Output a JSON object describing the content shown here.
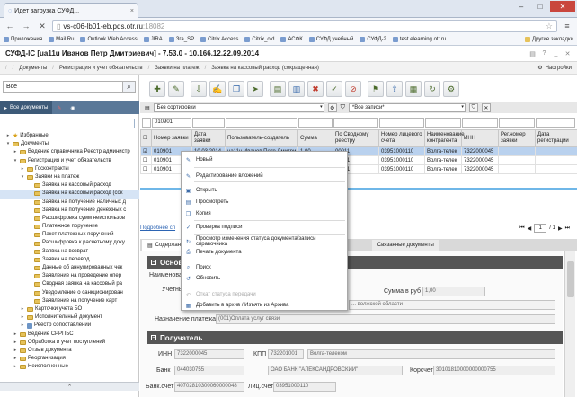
{
  "browser": {
    "tab_title": "Идет загрузка СУФД...",
    "url_domain": "vs-c06-lb01-eb.pds.otr.ru",
    "url_port": ":18082",
    "bookmarks": [
      "Приложения",
      "Mail.Ru",
      "Outlook Web Access",
      "JIRA",
      "Зга_SP",
      "Citrix Access",
      "Citrix_old",
      "АСФК",
      "СУФД учебный",
      "СУФД-2",
      "test.elearning.otr.ru"
    ],
    "other_bookmarks": "Другие закладки"
  },
  "app": {
    "title": "СУФД-IC [ua11u Иванов Петр Дмитриевич] - 7.53.0 - 10.166.12.22.09.2014",
    "breadcrumbs": [
      "Документы",
      "Регистрация и учет обязательств",
      "Заявки на платеж",
      "Заявка на кассовый расход (сокращенная)"
    ],
    "settings": "Настройки"
  },
  "left": {
    "search_value": "Все",
    "tab_all": "Все документы",
    "tree": [
      {
        "label": "Избранные",
        "level": 0,
        "exp": "▸",
        "icon": "star"
      },
      {
        "label": "Документы",
        "level": 0,
        "exp": "▾",
        "icon": "fold"
      },
      {
        "label": "Ведение справочника Реестр администр",
        "level": 1,
        "exp": "▸",
        "icon": "fold"
      },
      {
        "label": "Регистрация и учет обязательств",
        "level": 1,
        "exp": "▾",
        "icon": "fold"
      },
      {
        "label": "Госконтракты",
        "level": 2,
        "exp": "▸",
        "icon": "fold"
      },
      {
        "label": "Заявки на платеж",
        "level": 2,
        "exp": "▾",
        "icon": "fold"
      },
      {
        "label": "Заявка на кассовый расход",
        "level": 3,
        "exp": "",
        "icon": "fold"
      },
      {
        "label": "Заявка на кассовый расход (сок",
        "level": 3,
        "exp": "",
        "icon": "fold",
        "selected": true
      },
      {
        "label": "Заявка на получение наличных д",
        "level": 3,
        "exp": "",
        "icon": "fold"
      },
      {
        "label": "Заявка на получение денежных с",
        "level": 3,
        "exp": "",
        "icon": "fold"
      },
      {
        "label": "Расшифровка сумм неиспользов",
        "level": 3,
        "exp": "",
        "icon": "fold"
      },
      {
        "label": "Платежное поручение",
        "level": 3,
        "exp": "",
        "icon": "fold"
      },
      {
        "label": "Пакет платежных поручений",
        "level": 3,
        "exp": "",
        "icon": "fold"
      },
      {
        "label": "Расшифровка к расчетному доку",
        "level": 3,
        "exp": "",
        "icon": "fold"
      },
      {
        "label": "Заявка на возврат",
        "level": 3,
        "exp": "",
        "icon": "fold"
      },
      {
        "label": "Заявка на перевод",
        "level": 3,
        "exp": "",
        "icon": "fold"
      },
      {
        "label": "Данные об аннулированных чек",
        "level": 3,
        "exp": "",
        "icon": "fold"
      },
      {
        "label": "Заявление на проведение опер",
        "level": 3,
        "exp": "",
        "icon": "fold"
      },
      {
        "label": "Сводная заявка на кассовый ра",
        "level": 3,
        "exp": "",
        "icon": "fold"
      },
      {
        "label": "Уведомление о санкционирован",
        "level": 3,
        "exp": "",
        "icon": "fold"
      },
      {
        "label": "Заявление на получение карт",
        "level": 3,
        "exp": "",
        "icon": "fold"
      },
      {
        "label": "Карточки учета БО",
        "level": 2,
        "exp": "▸",
        "icon": "fold"
      },
      {
        "label": "Исполнительный документ",
        "level": 2,
        "exp": "▸",
        "icon": "fold"
      },
      {
        "label": "Реестр сопоставлений",
        "level": 2,
        "exp": "▸",
        "icon": "doc"
      },
      {
        "label": "Ведение СРРПБС",
        "level": 1,
        "exp": "▸",
        "icon": "fold"
      },
      {
        "label": "Обработка и учет поступлений",
        "level": 1,
        "exp": "▸",
        "icon": "fold"
      },
      {
        "label": "Отзыв документа",
        "level": 1,
        "exp": "▸",
        "icon": "fold"
      },
      {
        "label": "Реорганизация",
        "level": 1,
        "exp": "▸",
        "icon": "fold"
      },
      {
        "label": "Неисполненные",
        "level": 1,
        "exp": "▸",
        "icon": "fold"
      }
    ]
  },
  "filters": {
    "sort": "Без сортировки",
    "records": "*Все записи*",
    "number_filter": "010901"
  },
  "grid": {
    "columns": [
      "Номер заявки",
      "Дата заявки",
      "Пользователь-создатель",
      "Сумма",
      "По Сводному реестру",
      "Номер лицевого счета",
      "Наименование контрагента",
      "ИНН",
      "Рег.номер заявки",
      "Дата регистрации"
    ],
    "rows": [
      [
        "010901",
        "10.03.2014",
        "ua11u Иванов Петр Дмитри",
        "1,00",
        "00011",
        "03951000110",
        "Волга-телек",
        "7322000045",
        "",
        ""
      ],
      [
        "010901",
        "",
        "",
        "",
        "00011",
        "03951000110",
        "Волга-телек",
        "7322000045",
        "",
        ""
      ],
      [
        "010901",
        "",
        "",
        "",
        "00011",
        "03951000110",
        "Волга-телек",
        "7322000045",
        "",
        ""
      ]
    ]
  },
  "pager": {
    "link": "Подробнее сп",
    "current": "1",
    "total": "/ 1"
  },
  "detail_tabs": [
    "Содержание",
    "Связанные документы"
  ],
  "detail": {
    "section1": "Основн",
    "name_label": "Наименован",
    "participants_label": "Учетны",
    "sum_label": "Сумма в руб",
    "sum_value": "1,00",
    "region_text": "... волжской области",
    "purpose_label": "Назначение платежа",
    "purpose_value": "(001)Оплата услуг связи",
    "section2": "Получатель",
    "inn_label": "ИНН",
    "inn_value": "7322000045",
    "kpp_label": "КПП",
    "kpp_value": "732201001",
    "recipient_value": "Волга-телеком",
    "bank_label": "Банк",
    "bank_code": "044030755",
    "bank_value": "ОАО БАНК \"АЛЕКСАНДРОВСКИЙ\"",
    "corr_label": "Корсчет",
    "corr_value": "30101810000000000755",
    "bank_acct_label": "Банк.счет",
    "bank_acct_value": "40702810300060000048",
    "personal_label": "Лиц.счет",
    "personal_value": "03951000110"
  },
  "context_menu": [
    {
      "label": "Новый",
      "icon": "new-icon",
      "glyph": "✎",
      "disabled": false
    },
    {
      "label": "Редактирование вложений",
      "icon": "attachment-icon",
      "glyph": "✎",
      "disabled": false
    },
    {
      "label": "Открыть",
      "icon": "open-icon",
      "glyph": "▣",
      "disabled": false
    },
    {
      "label": "Просмотреть",
      "icon": "view-icon",
      "glyph": "▤",
      "disabled": false
    },
    {
      "label": "Копия",
      "icon": "copy-icon",
      "glyph": "❐",
      "disabled": false
    },
    {
      "label": "Проверка подписи",
      "icon": "signature-icon",
      "glyph": "✓",
      "disabled": false
    },
    {
      "label": "Просмотр изменения статуса документа/записи справочника",
      "icon": "history-icon",
      "glyph": "↻",
      "disabled": false
    },
    {
      "label": "Печать документа",
      "icon": "print-icon",
      "glyph": "⎙",
      "disabled": false
    },
    {
      "label": "Поиск",
      "icon": "search-icon",
      "glyph": "⌕",
      "disabled": false
    },
    {
      "label": "Обновить",
      "icon": "refresh-icon",
      "glyph": "↺",
      "disabled": false
    },
    {
      "label": "Откат статуса передачи",
      "icon": "rollback-icon",
      "glyph": "↶",
      "disabled": true
    },
    {
      "label": "Добавить в архив / Изъять из Архива",
      "icon": "archive-icon",
      "glyph": "▦",
      "disabled": false
    }
  ],
  "colors": {
    "panel_tab": "#5a7898",
    "selection": "#b9d1ee",
    "section_header": "#555555"
  }
}
